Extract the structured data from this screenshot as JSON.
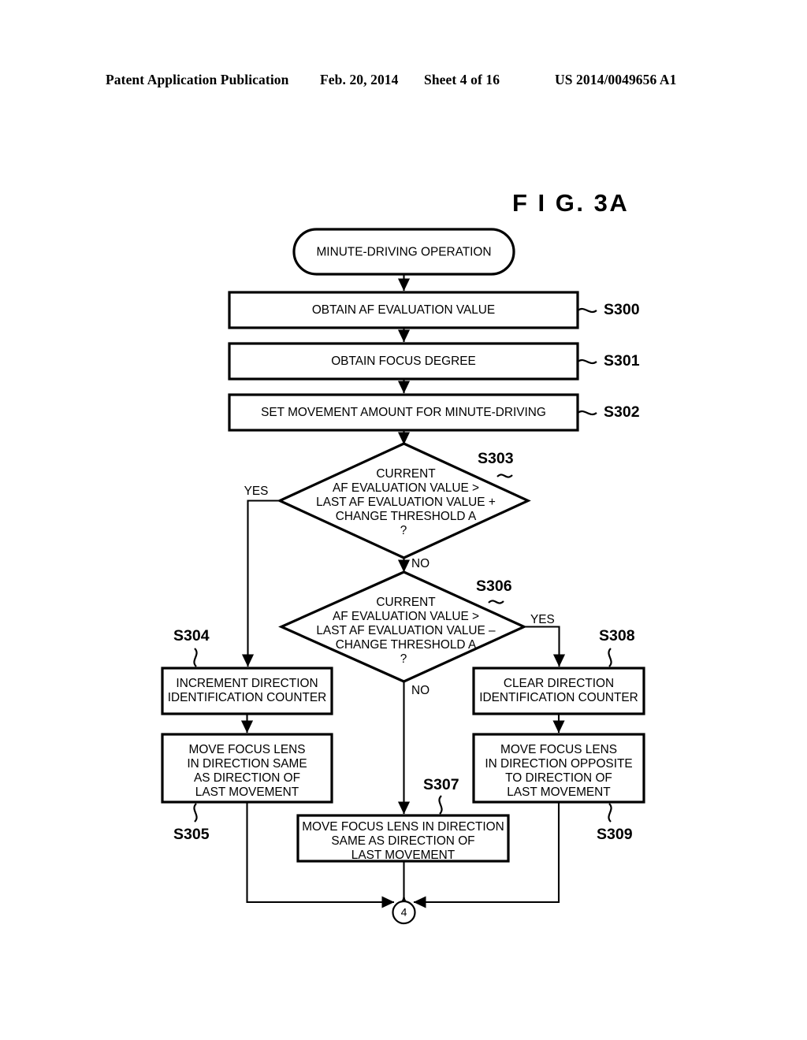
{
  "header": {
    "publication": "Patent Application Publication",
    "date": "Feb. 20, 2014",
    "sheet": "Sheet 4 of 16",
    "patent_number": "US 2014/0049656 A1"
  },
  "figure": {
    "title": "F I G.  3A"
  },
  "flowchart": {
    "start": {
      "id": "start",
      "text": "MINUTE-DRIVING OPERATION"
    },
    "steps": [
      {
        "id": "S300",
        "label": "S300",
        "text": "OBTAIN AF EVALUATION VALUE"
      },
      {
        "id": "S301",
        "label": "S301",
        "text": "OBTAIN FOCUS DEGREE"
      },
      {
        "id": "S302",
        "label": "S302",
        "text": "SET MOVEMENT AMOUNT FOR MINUTE-DRIVING"
      }
    ],
    "decisions": [
      {
        "id": "S303",
        "label": "S303",
        "lines": [
          "CURRENT",
          "AF EVALUATION VALUE >",
          "LAST AF EVALUATION VALUE +",
          "CHANGE THRESHOLD A",
          "?"
        ],
        "yes_label": "YES",
        "no_label": "NO"
      },
      {
        "id": "S306",
        "label": "S306",
        "lines": [
          "CURRENT",
          "AF EVALUATION VALUE >",
          "LAST AF EVALUATION VALUE –",
          "CHANGE THRESHOLD A",
          "?"
        ],
        "yes_label": "YES",
        "no_label": "NO"
      }
    ],
    "branch_boxes": [
      {
        "id": "S304",
        "label": "S304",
        "lines": [
          "INCREMENT DIRECTION",
          "IDENTIFICATION COUNTER"
        ]
      },
      {
        "id": "S305",
        "label": "S305",
        "lines": [
          "MOVE FOCUS LENS",
          "IN DIRECTION SAME",
          "AS DIRECTION OF",
          "LAST MOVEMENT"
        ]
      },
      {
        "id": "S307",
        "label": "S307",
        "lines": [
          "MOVE FOCUS LENS IN DIRECTION",
          "SAME AS DIRECTION OF",
          "LAST MOVEMENT"
        ]
      },
      {
        "id": "S308",
        "label": "S308",
        "lines": [
          "CLEAR DIRECTION",
          "IDENTIFICATION COUNTER"
        ]
      },
      {
        "id": "S309",
        "label": "S309",
        "lines": [
          "MOVE FOCUS LENS",
          "IN DIRECTION OPPOSITE",
          "TO DIRECTION OF",
          "LAST MOVEMENT"
        ]
      }
    ],
    "connector": {
      "id": "offpage-4",
      "text": "4"
    }
  },
  "colors": {
    "ink": "#000000",
    "paper": "#ffffff"
  }
}
